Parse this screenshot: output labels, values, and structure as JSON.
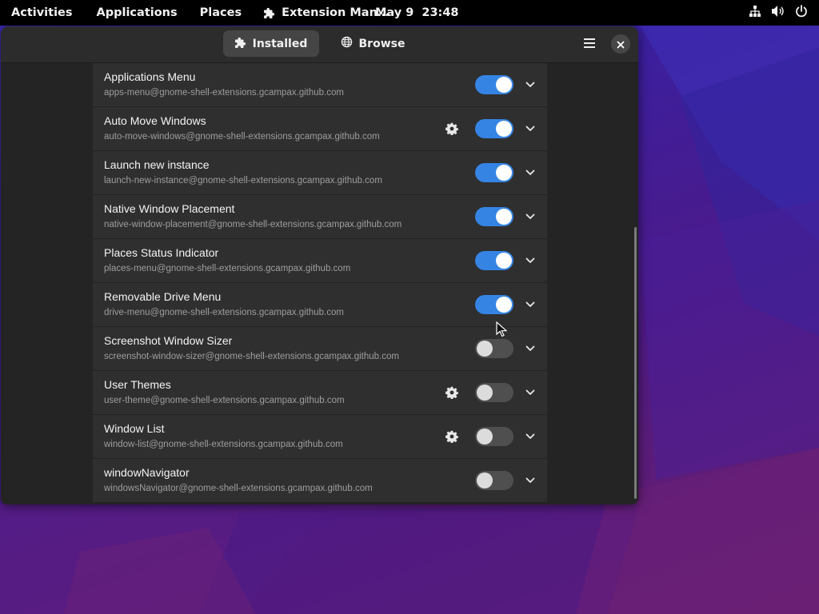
{
  "topbar": {
    "activities": "Activities",
    "applications": "Applications",
    "places": "Places",
    "app_name": "Extension Man…",
    "date": "May 9",
    "time": "23:48",
    "icons": [
      "network-icon",
      "volume-icon",
      "power-icon"
    ]
  },
  "window": {
    "tabs": [
      {
        "label": "Installed",
        "icon": "puzzle-icon",
        "active": true
      },
      {
        "label": "Browse",
        "icon": "globe-icon",
        "active": false
      }
    ],
    "menu_icon": "hamburger-menu-icon",
    "close_icon": "close-icon"
  },
  "extensions": [
    {
      "name": "Applications Menu",
      "id": "apps-menu@gnome-shell-extensions.gcampax.github.com",
      "enabled": true,
      "settings": false
    },
    {
      "name": "Auto Move Windows",
      "id": "auto-move-windows@gnome-shell-extensions.gcampax.github.com",
      "enabled": true,
      "settings": true
    },
    {
      "name": "Launch new instance",
      "id": "launch-new-instance@gnome-shell-extensions.gcampax.github.com",
      "enabled": true,
      "settings": false
    },
    {
      "name": "Native Window Placement",
      "id": "native-window-placement@gnome-shell-extensions.gcampax.github.com",
      "enabled": true,
      "settings": false
    },
    {
      "name": "Places Status Indicator",
      "id": "places-menu@gnome-shell-extensions.gcampax.github.com",
      "enabled": true,
      "settings": false
    },
    {
      "name": "Removable Drive Menu",
      "id": "drive-menu@gnome-shell-extensions.gcampax.github.com",
      "enabled": true,
      "settings": false
    },
    {
      "name": "Screenshot Window Sizer",
      "id": "screenshot-window-sizer@gnome-shell-extensions.gcampax.github.com",
      "enabled": false,
      "settings": false
    },
    {
      "name": "User Themes",
      "id": "user-theme@gnome-shell-extensions.gcampax.github.com",
      "enabled": false,
      "settings": true
    },
    {
      "name": "Window List",
      "id": "window-list@gnome-shell-extensions.gcampax.github.com",
      "enabled": false,
      "settings": true
    },
    {
      "name": "windowNavigator",
      "id": "windowsNavigator@gnome-shell-extensions.gcampax.github.com",
      "enabled": false,
      "settings": false
    }
  ],
  "colors": {
    "accent": "#3584e4",
    "window_bg": "#242424",
    "row_bg": "#2f2f2f"
  }
}
